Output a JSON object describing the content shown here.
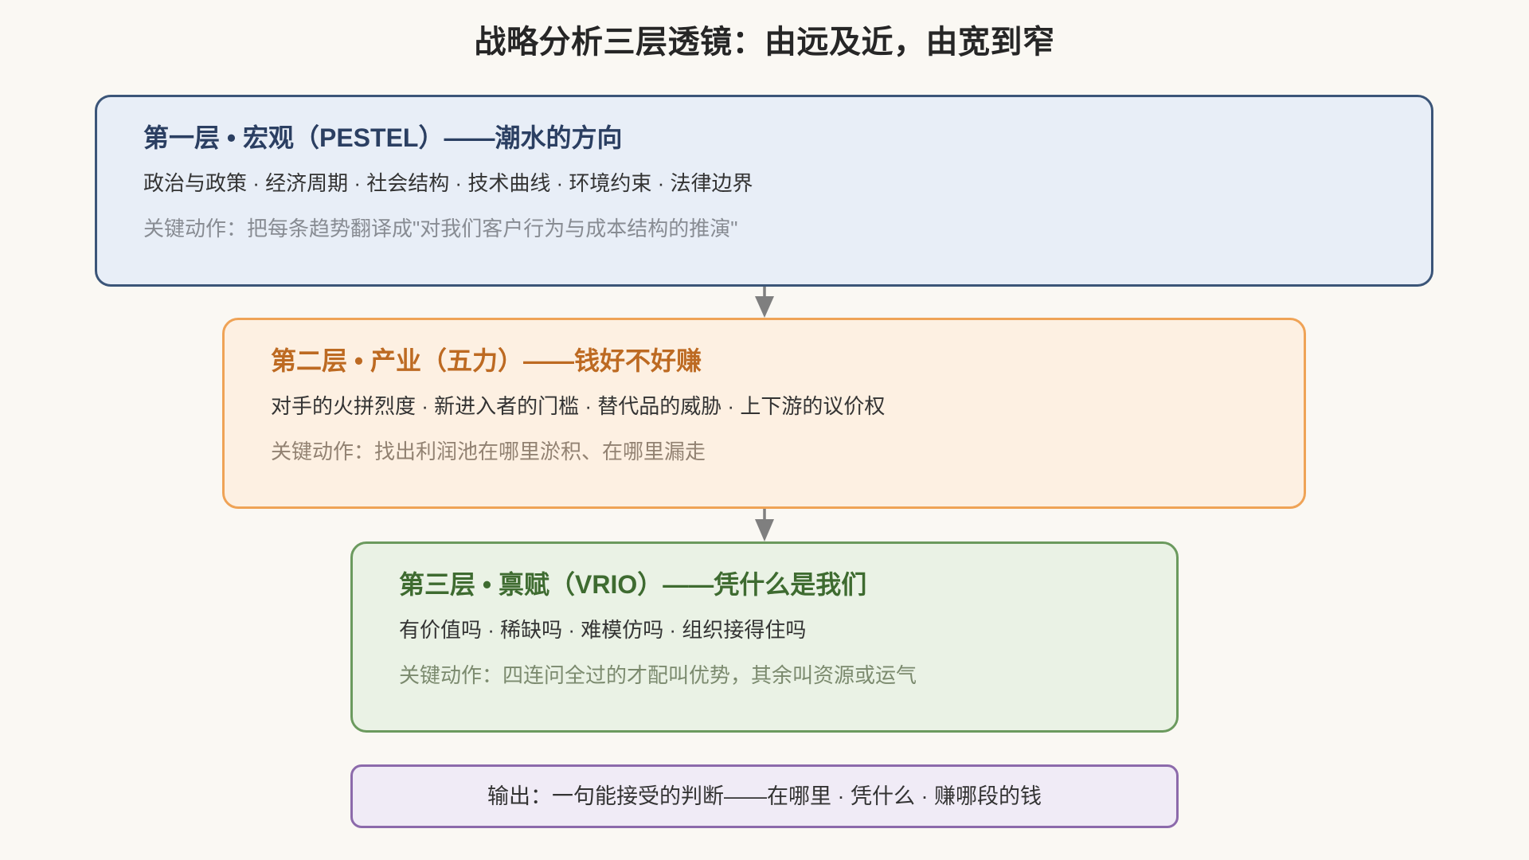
{
  "title": "战略分析三层透镜：由远及近，由宽到窄",
  "colors": {
    "background": "#faf8f3",
    "title": "#262626",
    "arrow": "#7f7f7f",
    "body_text": "#333333"
  },
  "layers": [
    {
      "heading": "第一层 • 宏观（PESTEL）——潮水的方向",
      "items": "政治与政策 · 经济周期 · 社会结构 · 技术曲线 · 环境约束 · 法律边界",
      "action": "关键动作：把每条趋势翻译成\"对我们客户行为与成本结构的推演\"",
      "colors": {
        "border": "#3b5578",
        "fill": "#e8eef7",
        "heading": "#2b3f62",
        "action": "#888c93"
      }
    },
    {
      "heading": "第二层 • 产业（五力）——钱好不好赚",
      "items": "对手的火拼烈度 · 新进入者的门槛 · 替代品的威胁 · 上下游的议价权",
      "action": "关键动作：找出利润池在哪里淤积、在哪里漏走",
      "colors": {
        "border": "#efa356",
        "fill": "#fdf0e2",
        "heading": "#bd6a22",
        "action": "#928272"
      }
    },
    {
      "heading": "第三层 • 禀赋（VRIO）——凭什么是我们",
      "items": "有价值吗 · 稀缺吗 · 难模仿吗 · 组织接得住吗",
      "action": "关键动作：四连问全过的才配叫优势，其余叫资源或运气",
      "colors": {
        "border": "#6b9a5e",
        "fill": "#eaf2e5",
        "heading": "#3e6b30",
        "action": "#7b8a6e"
      }
    }
  ],
  "output": {
    "text": "输出：一句能接受的判断——在哪里 · 凭什么 · 赚哪段的钱",
    "colors": {
      "border": "#8c6aab",
      "fill": "#f0ebf6"
    }
  }
}
